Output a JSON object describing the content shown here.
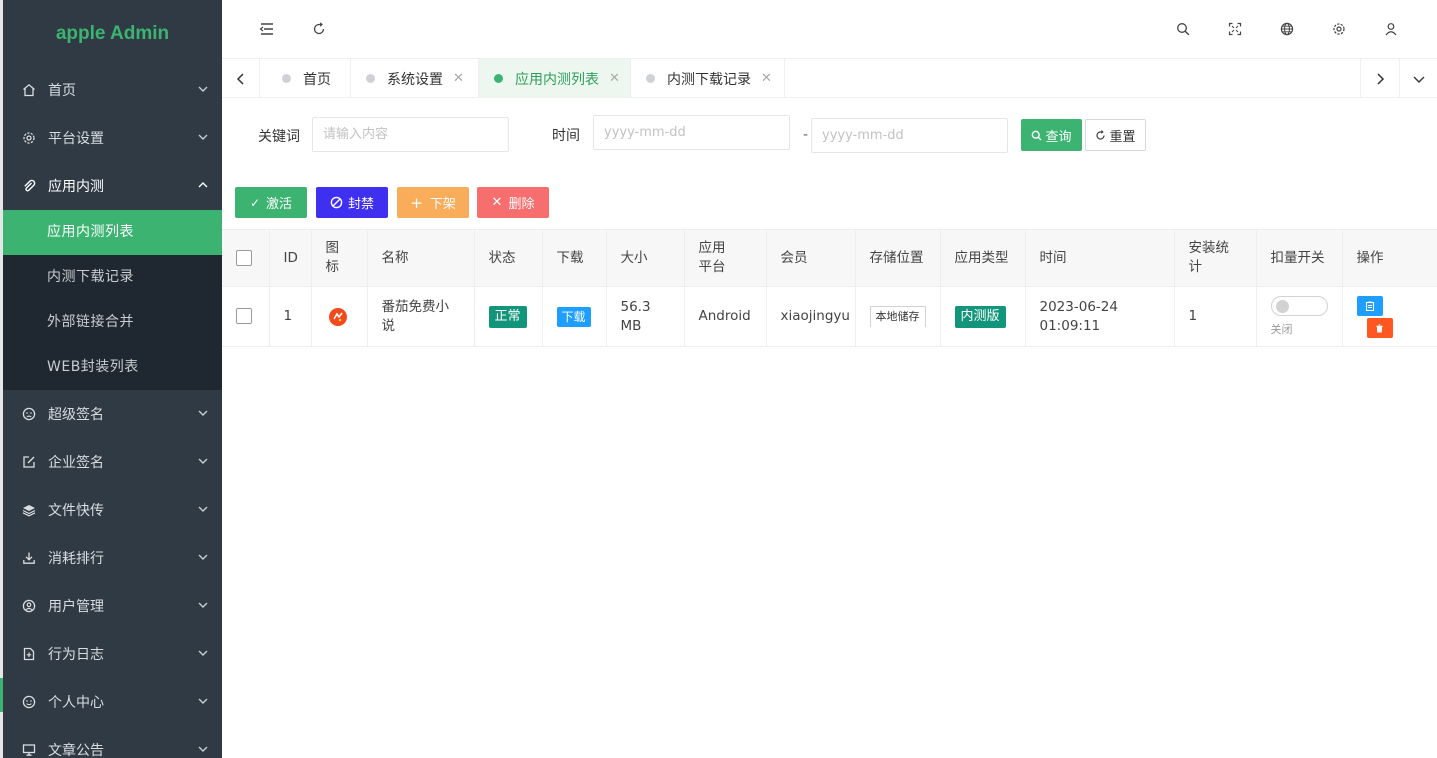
{
  "brand": {
    "title": "apple Admin",
    "accent": "#3cb371"
  },
  "sidebar": {
    "items": [
      {
        "label": "首页",
        "icon": "home-icon"
      },
      {
        "label": "平台设置",
        "icon": "gear-icon"
      },
      {
        "label": "应用内测",
        "icon": "paperclip-icon",
        "open": true
      },
      {
        "label": "超级签名",
        "icon": "face-icon"
      },
      {
        "label": "企业签名",
        "icon": "edit-icon"
      },
      {
        "label": "文件快传",
        "icon": "layers-icon"
      },
      {
        "label": "消耗排行",
        "icon": "download-icon"
      },
      {
        "label": "用户管理",
        "icon": "user-circle-icon"
      },
      {
        "label": "行为日志",
        "icon": "file-plus-icon"
      },
      {
        "label": "个人中心",
        "icon": "smile-icon"
      },
      {
        "label": "文章公告",
        "icon": "monitor-icon"
      }
    ],
    "submenu": [
      {
        "label": "应用内测列表",
        "active": true
      },
      {
        "label": "内测下载记录"
      },
      {
        "label": "外部链接合并"
      },
      {
        "label": "WEB封装列表"
      }
    ]
  },
  "tabs": [
    {
      "label": "首页"
    },
    {
      "label": "系统设置",
      "close": "✕"
    },
    {
      "label": "应用内测列表",
      "close": "✕",
      "active": true
    },
    {
      "label": "内测下载记录",
      "close": "✕"
    }
  ],
  "filter": {
    "keyword_label": "关键词",
    "keyword_placeholder": "请输入内容",
    "time_label": "时间",
    "date_start_placeholder": "yyyy-mm-dd",
    "date_sep": "-",
    "date_end_placeholder": "yyyy-mm-dd",
    "search_label": "查询",
    "reset_label": "重置"
  },
  "actions": {
    "activate": "激活",
    "ban": "封禁",
    "offline": "下架",
    "delete": "删除"
  },
  "table": {
    "headers": [
      "ID",
      "图标",
      "名称",
      "状态",
      "下载",
      "大小",
      "应用平台",
      "会员",
      "存储位置",
      "应用类型",
      "时间",
      "安装统计",
      "扣量开关",
      "操作"
    ],
    "rows": [
      {
        "id": "1",
        "name": "番茄免费小说",
        "status": "正常",
        "download": "下载",
        "size": "56.3 MB",
        "platform": "Android",
        "member": "xiaojingyu",
        "storage": "本地储存",
        "type": "内测版",
        "time": "2023-06-24 01:09:11",
        "installs": "1",
        "deduct_switch": "关闭"
      }
    ]
  },
  "colors": {
    "green": "#3cb371",
    "blue": "#3f2ff0",
    "orange": "#f9ad5a",
    "red": "#f76e6e",
    "teal": "#12957a",
    "info_blue": "#1e9fff",
    "op_red": "#ff5722"
  }
}
